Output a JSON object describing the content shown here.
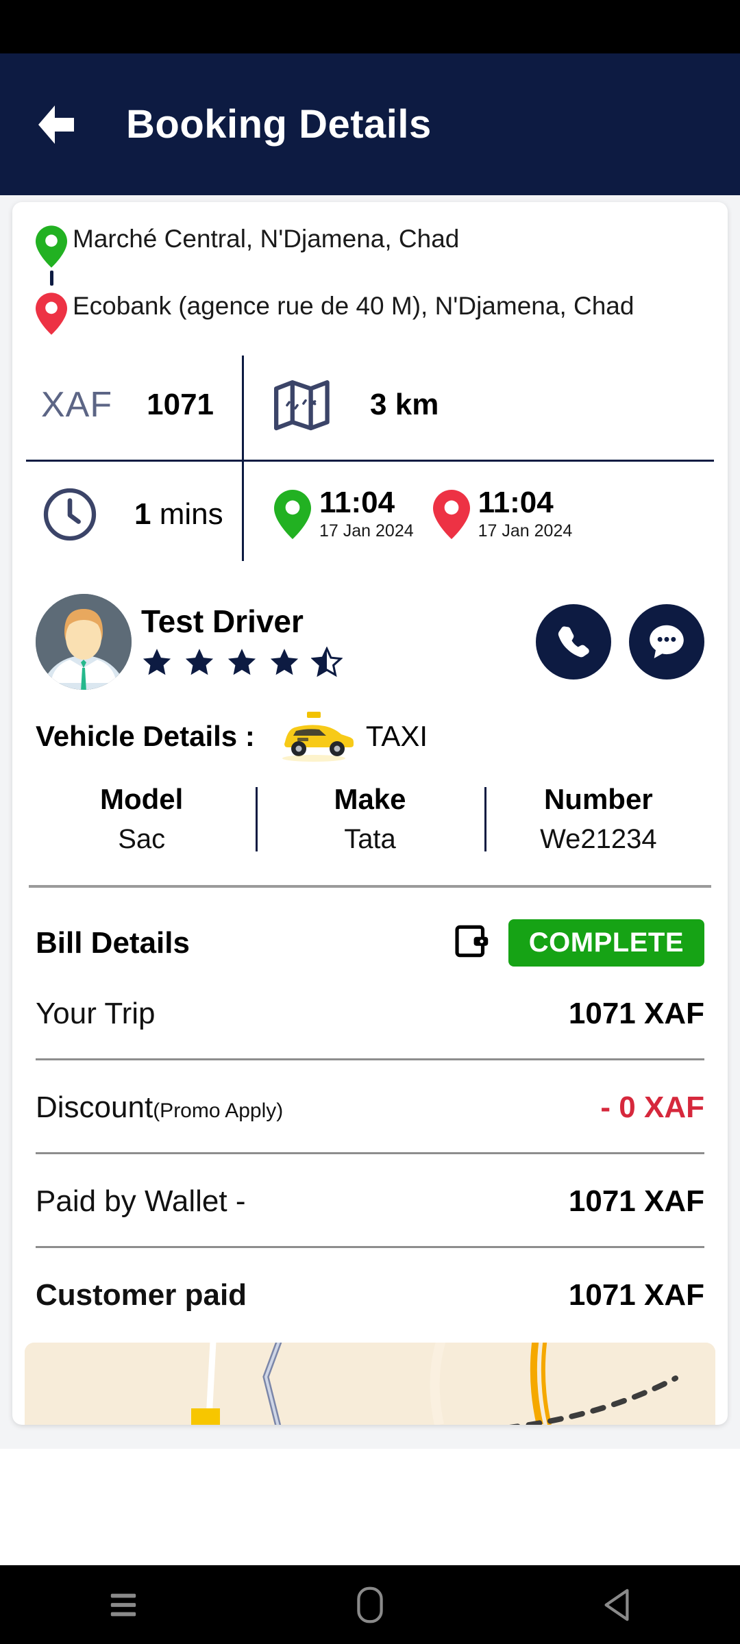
{
  "app": {
    "title": "Booking Details",
    "accent_navy": "#0d1b42",
    "green": "#22b122",
    "red": "#ed3244",
    "complete_green": "#16a315"
  },
  "trip": {
    "pickup_address": "Marché Central, N'Djamena, Chad",
    "drop_address": "Ecobank (agence rue de 40 M), N'Djamena, Chad",
    "currency_label": "XAF",
    "fare_value": "1071",
    "distance_value": "3",
    "distance_unit": "km",
    "duration_value": "1",
    "duration_unit": "mins",
    "pickup_time": "11:04",
    "pickup_date": "17 Jan 2024",
    "drop_time": "11:04",
    "drop_date": "17 Jan 2024"
  },
  "driver": {
    "name": "Test Driver",
    "rating_filled": 4,
    "rating_half": true,
    "call_label": "Call",
    "chat_label": "Chat"
  },
  "vehicle": {
    "section_label": "Vehicle Details  :",
    "type": "TAXI",
    "columns": [
      {
        "header": "Model",
        "value": "Sac"
      },
      {
        "header": "Make",
        "value": "Tata"
      },
      {
        "header": "Number",
        "value": "We21234"
      }
    ]
  },
  "bill": {
    "title": "Bill Details",
    "status": "COMPLETE",
    "rows": [
      {
        "label": "Your Trip",
        "sub": "",
        "amount": "1071 XAF",
        "negative": false,
        "bold_label": false
      },
      {
        "label": "Discount",
        "sub": "(Promo Apply)",
        "amount": "- 0 XAF",
        "negative": true,
        "bold_label": false
      },
      {
        "label": "Paid by Wallet -",
        "sub": "",
        "amount": "1071 XAF",
        "negative": false,
        "bold_label": false
      },
      {
        "label": "Customer paid",
        "sub": "",
        "amount": "1071 XAF",
        "negative": false,
        "bold_label": true
      }
    ]
  },
  "nav": {
    "recents": "recents-button",
    "home": "home-button",
    "back": "back-button"
  }
}
